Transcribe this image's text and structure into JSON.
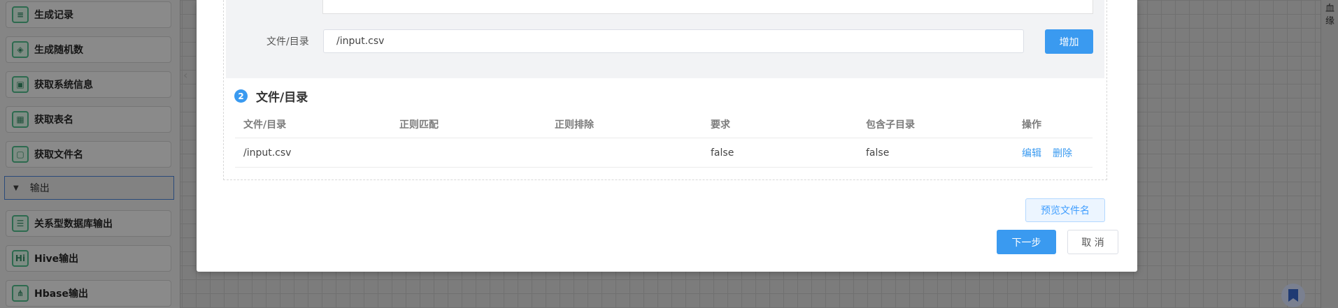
{
  "sidebar": {
    "items": [
      {
        "label": "生成记录",
        "icon": "document-icon"
      },
      {
        "label": "生成随机数",
        "icon": "cube-icon"
      },
      {
        "label": "获取系统信息",
        "icon": "monitor-icon"
      },
      {
        "label": "获取表名",
        "icon": "table-icon"
      },
      {
        "label": "获取文件名",
        "icon": "file-icon"
      }
    ],
    "section": {
      "label": "输出"
    },
    "output_items": [
      {
        "label": "关系型数据库输出",
        "icon": "database-icon",
        "glyph": ""
      },
      {
        "label": "Hive输出",
        "icon": "hive-icon",
        "glyph": "Hi"
      },
      {
        "label": "Hbase输出",
        "icon": "hbase-icon",
        "glyph": ""
      }
    ]
  },
  "right_rail": {
    "text": "血缘"
  },
  "dialog": {
    "file_label": "文件/目录",
    "file_input_value": "/input.csv",
    "add_button": "增加",
    "step": {
      "number": "2",
      "title": "文件/目录"
    },
    "table": {
      "headers": [
        "文件/目录",
        "正则匹配",
        "正则排除",
        "要求",
        "包含子目录",
        "操作"
      ],
      "rows": [
        {
          "path": "/input.csv",
          "regex_match": "",
          "regex_exclude": "",
          "required": "false",
          "include_subdirs": "false",
          "actions": [
            "编辑",
            "删除"
          ]
        }
      ]
    },
    "preview_button": "预览文件名",
    "next_button": "下一步",
    "cancel_button": "取 消"
  },
  "colors": {
    "primary": "#3a9af0",
    "icon_green": "#2d6a4f"
  }
}
